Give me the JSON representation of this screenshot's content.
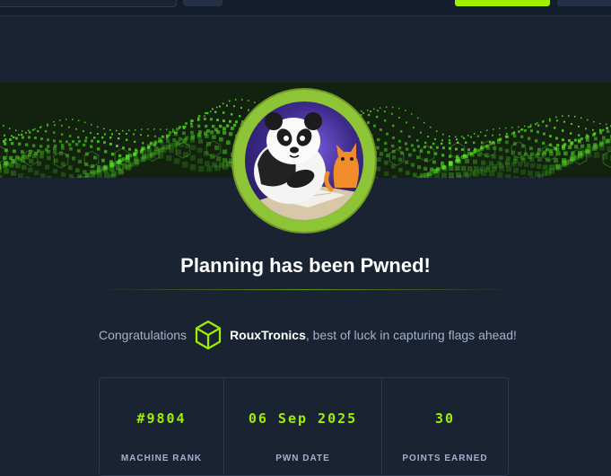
{
  "page": {
    "title": "Planning has been Pwned!",
    "congrats_prefix": "Congratulations",
    "username": "RouxTronics",
    "congrats_suffix": ", best of luck in capturing flags ahead!"
  },
  "stats": [
    {
      "value": "#9804",
      "label": "MACHINE RANK"
    },
    {
      "value": "06 Sep 2025",
      "label": "PWN DATE"
    },
    {
      "value": "30",
      "label": "POINTS EARNED"
    }
  ],
  "icons": {
    "avatar": "panda-cat-avatar",
    "user_badge": "cube-icon"
  },
  "colors": {
    "accent": "#9fef00",
    "background": "#1a2332",
    "text": "#a4b1cd"
  }
}
